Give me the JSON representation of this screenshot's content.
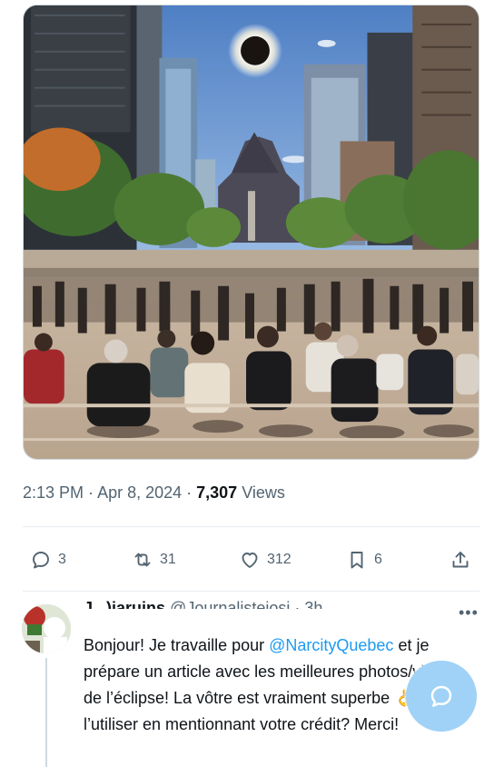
{
  "post": {
    "time": "2:13 PM",
    "separator": " · ",
    "date": "Apr 8, 2024",
    "views_count": "7,307",
    "views_label": "Views"
  },
  "actions": {
    "replies": "3",
    "reposts": "31",
    "likes": "312",
    "bookmarks": "6"
  },
  "reply": {
    "author_name": "J      ,   )jaruins",
    "author_handle": "@Journalistejosi · 3h",
    "text_before_mention": "Bonjour! Je travaille pour ",
    "mention": "@NarcityQuebec",
    "text_after_mention": " et je prépare un article avec les meilleures photos/videos de l’éclipse! La vôtre est vraiment superbe ",
    "emoji": "👌",
    "text_end": "puis-je l’utiliser en mentionnant votre crédit? Merci!"
  },
  "icons": {
    "reply": "reply-icon",
    "repost": "repost-icon",
    "like": "heart-icon",
    "bookmark": "bookmark-icon",
    "share": "share-icon",
    "more": "more-icon",
    "compose": "compose-reply-icon"
  },
  "colors": {
    "accent": "#1d9bf0",
    "secondary_text": "#536471",
    "fab": "#9fd2f6"
  }
}
